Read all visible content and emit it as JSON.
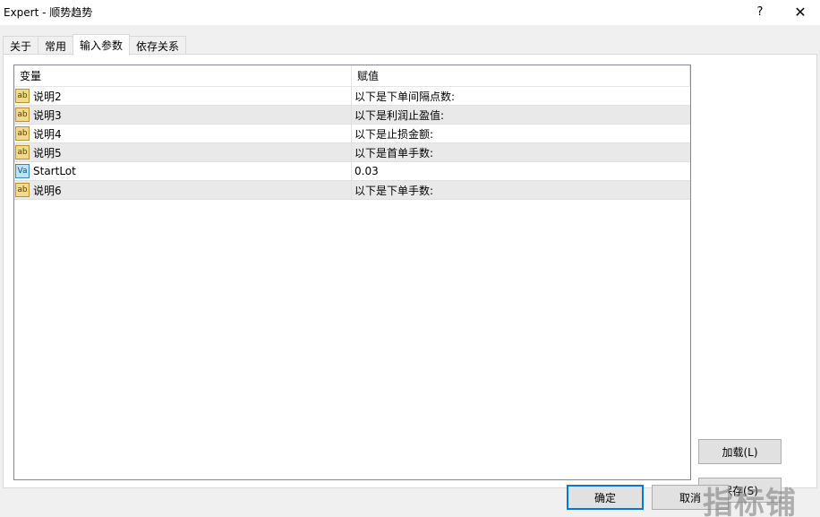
{
  "window": {
    "title": "Expert - 顺势趋势",
    "help_label": "?",
    "close_label": "✕"
  },
  "tabs": [
    {
      "label": "关于"
    },
    {
      "label": "常用"
    },
    {
      "label": "输入参数"
    },
    {
      "label": "依存关系"
    }
  ],
  "grid": {
    "col_variable": "变量",
    "col_value": "赋值",
    "rows": [
      {
        "icon": "ab",
        "name": "说明2",
        "value": "以下是下单间隔点数:"
      },
      {
        "icon": "ab",
        "name": "说明3",
        "value": "以下是利润止盈值:"
      },
      {
        "icon": "ab",
        "name": "说明4",
        "value": "以下是止损金额:"
      },
      {
        "icon": "ab",
        "name": "说明5",
        "value": "以下是首单手数:"
      },
      {
        "icon": "Va",
        "name": "StartLot",
        "value": "0.03"
      },
      {
        "icon": "ab",
        "name": "说明6",
        "value": "以下是下单手数:"
      }
    ]
  },
  "buttons": {
    "load": "加载(L)",
    "save": "保存(S)",
    "ok": "确定",
    "cancel": "取消"
  },
  "watermark": "指标铺"
}
